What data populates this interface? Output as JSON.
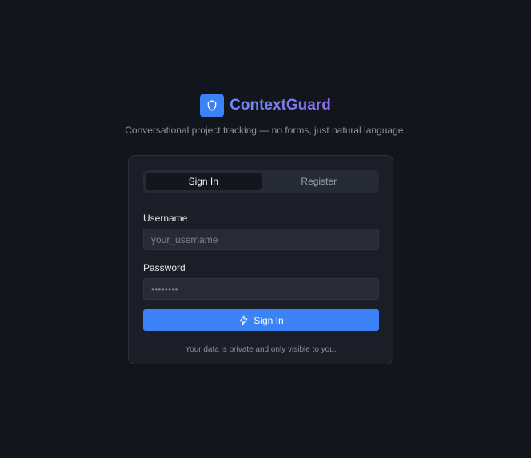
{
  "brand": {
    "title": "ContextGuard",
    "tagline": "Conversational project tracking — no forms, just natural language.",
    "logo_icon": "shield-icon",
    "accent": "#3b82f6"
  },
  "auth": {
    "tabs": [
      {
        "label": "Sign In",
        "active": true
      },
      {
        "label": "Register",
        "active": false
      }
    ],
    "username": {
      "label": "Username",
      "placeholder": "your_username",
      "value": ""
    },
    "password": {
      "label": "Password",
      "placeholder": "••••••••",
      "value": ""
    },
    "submit": {
      "label": "Sign In",
      "icon": "lightning-icon"
    },
    "note": "Your data is private and only visible to you."
  }
}
